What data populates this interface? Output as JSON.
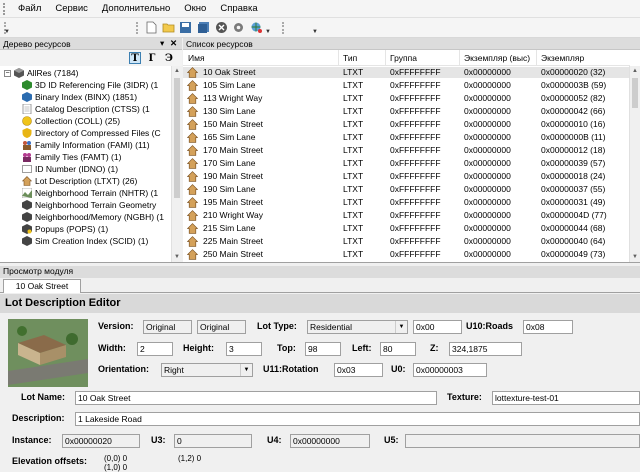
{
  "menu": {
    "items": [
      "Файл",
      "Сервис",
      "Дополнительно",
      "Окно",
      "Справка"
    ]
  },
  "tree_panel": {
    "title": "Дерево ресурсов",
    "pin": "▾",
    "close": "✕",
    "tool_buttons": [
      "T",
      "Г",
      "Э"
    ],
    "root_label": "AllRes (7184)",
    "items": [
      {
        "label": "3D ID Referencing File (3IDR) (1",
        "icon": "green-cube-icon"
      },
      {
        "label": "Binary Index (BINX) (1851)",
        "icon": "blue-cube-icon"
      },
      {
        "label": "Catalog Description (CTSS) (1",
        "icon": "doc-icon"
      },
      {
        "label": "Collection (COLL) (25)",
        "icon": "yellow-ball-icon"
      },
      {
        "label": "Directory of Compressed Files (C",
        "icon": "yellow-shield-icon"
      },
      {
        "label": "Family Information (FAMI) (11)",
        "icon": "family-icon"
      },
      {
        "label": "Family Ties (FAMT) (1)",
        "icon": "family-ties-icon"
      },
      {
        "label": "ID Number (IDNO) (1)",
        "icon": "id-icon"
      },
      {
        "label": "Lot Description (LTXT) (26)",
        "icon": "house-icon"
      },
      {
        "label": "Neighborhood Terrain (NHTR) (1",
        "icon": "terrain-icon"
      },
      {
        "label": "Neighborhood Terrain Geometry",
        "icon": "dark-cube-icon"
      },
      {
        "label": "Neighborhood/Memory (NGBH) (1",
        "icon": "dark-cube-icon"
      },
      {
        "label": "Popups (POPS) (1)",
        "icon": "popup-icon"
      },
      {
        "label": "Sim Creation Index (SCID) (1)",
        "icon": "dark-cube-icon"
      }
    ]
  },
  "list_panel": {
    "title": "Список ресурсов",
    "columns": [
      "Имя",
      "Тип",
      "Группа",
      "Экземпляр (выс)",
      "Экземпляр"
    ],
    "rows": [
      [
        "10 Oak Street",
        "LTXT",
        "0xFFFFFFFF",
        "0x00000000",
        "0x00000020 (32)"
      ],
      [
        "105 Sim Lane",
        "LTXT",
        "0xFFFFFFFF",
        "0x00000000",
        "0x0000003B (59)"
      ],
      [
        "113 Wright Way",
        "LTXT",
        "0xFFFFFFFF",
        "0x00000000",
        "0x00000052 (82)"
      ],
      [
        "130 Sim Lane",
        "LTXT",
        "0xFFFFFFFF",
        "0x00000000",
        "0x00000042 (66)"
      ],
      [
        "150 Main Street",
        "LTXT",
        "0xFFFFFFFF",
        "0x00000000",
        "0x00000010 (16)"
      ],
      [
        "165 Sim Lane",
        "LTXT",
        "0xFFFFFFFF",
        "0x00000000",
        "0x0000000B (11)"
      ],
      [
        "170 Main Street",
        "LTXT",
        "0xFFFFFFFF",
        "0x00000000",
        "0x00000012 (18)"
      ],
      [
        "170 Sim Lane",
        "LTXT",
        "0xFFFFFFFF",
        "0x00000000",
        "0x00000039 (57)"
      ],
      [
        "190 Main Street",
        "LTXT",
        "0xFFFFFFFF",
        "0x00000000",
        "0x00000018 (24)"
      ],
      [
        "190 Sim Lane",
        "LTXT",
        "0xFFFFFFFF",
        "0x00000000",
        "0x00000037 (55)"
      ],
      [
        "195 Main Street",
        "LTXT",
        "0xFFFFFFFF",
        "0x00000000",
        "0x00000031 (49)"
      ],
      [
        "210 Wright Way",
        "LTXT",
        "0xFFFFFFFF",
        "0x00000000",
        "0x0000004D (77)"
      ],
      [
        "215 Sim Lane",
        "LTXT",
        "0xFFFFFFFF",
        "0x00000000",
        "0x00000044 (68)"
      ],
      [
        "225 Main Street",
        "LTXT",
        "0xFFFFFFFF",
        "0x00000000",
        "0x00000040 (64)"
      ],
      [
        "250 Main Street",
        "LTXT",
        "0xFFFFFFFF",
        "0x00000000",
        "0x00000049 (73)"
      ]
    ]
  },
  "preview": {
    "title": "Просмотр модуля",
    "tab": "10 Oak Street",
    "editor_title": "Lot Description Editor",
    "version_label": "Version:",
    "version_a": "Original",
    "version_b": "Original",
    "lot_type_label": "Lot Type:",
    "lot_type_value": "Residential",
    "lot_type_hex": "0x00",
    "u10_label": "U10:Roads",
    "u10_value": "0x08",
    "width_label": "Width:",
    "width_value": "2",
    "height_label": "Height:",
    "height_value": "3",
    "top_label": "Top:",
    "top_value": "98",
    "left_label": "Left:",
    "left_value": "80",
    "z_label": "Z:",
    "z_value": "324,1875",
    "orientation_label": "Orientation:",
    "orientation_value": "Right",
    "rotation_label": "U11:Rotation",
    "rotation_value": "0x03",
    "u0_label": "U0:",
    "u0_value": "0x00000003",
    "lot_name_label": "Lot Name:",
    "lot_name_value": "10 Oak Street",
    "texture_label": "Texture:",
    "texture_value": "lottexture-test-01",
    "description_label": "Description:",
    "description_value": "1 Lakeside Road",
    "instance_label": "Instance:",
    "instance_value": "0x00000020",
    "u3_label": "U3:",
    "u3_value": "0",
    "u4_label": "U4:",
    "u4_value": "0x00000000",
    "u5_label": "U5:",
    "u5_value": "",
    "elevation_label": "Elevation offsets:",
    "elevation_values": [
      "(0,0) 0",
      "(1,2) 0",
      "(1,0) 0",
      ""
    ]
  }
}
